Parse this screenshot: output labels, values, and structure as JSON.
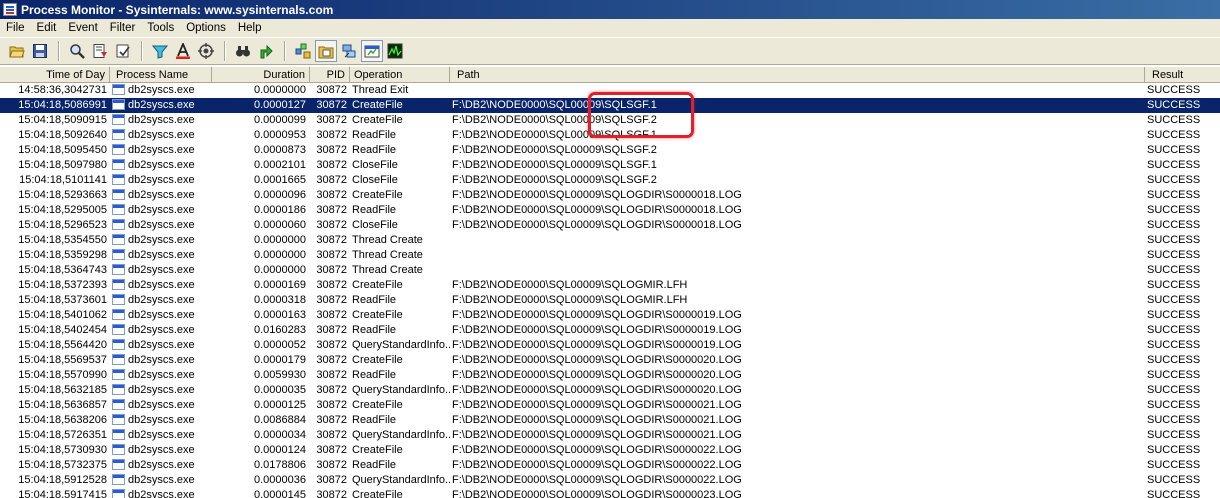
{
  "window": {
    "title": "Process Monitor - Sysinternals: www.sysinternals.com"
  },
  "menu": [
    "File",
    "Edit",
    "Event",
    "Filter",
    "Tools",
    "Options",
    "Help"
  ],
  "toolbar": [
    {
      "icon": "open-icon"
    },
    {
      "icon": "save-icon"
    },
    {
      "icon": "magnify-icon"
    },
    {
      "icon": "autoscroll-icon"
    },
    {
      "icon": "clear-icon"
    },
    {
      "icon": "filter-icon"
    },
    {
      "icon": "highlight-icon"
    },
    {
      "icon": "target-icon"
    },
    {
      "icon": "find-icon"
    },
    {
      "icon": "jump-icon"
    },
    {
      "icon": "registry-icon"
    },
    {
      "icon": "filesystem-icon"
    },
    {
      "icon": "network-icon"
    },
    {
      "icon": "process-icon"
    },
    {
      "icon": "profiling-icon"
    }
  ],
  "columns": {
    "time": "Time of Day",
    "process": "Process Name",
    "duration": "Duration",
    "pid": "PID",
    "operation": "Operation",
    "path": "Path",
    "result": "Result"
  },
  "rows": [
    {
      "time": "14:58:36,3042731",
      "process": "db2syscs.exe",
      "duration": "0.0000000",
      "pid": "30872",
      "operation": "Thread Exit",
      "path": "",
      "result": "SUCCESS"
    },
    {
      "time": "15:04:18,5086991",
      "process": "db2syscs.exe",
      "duration": "0.0000127",
      "pid": "30872",
      "operation": "CreateFile",
      "path": "F:\\DB2\\NODE0000\\SQL00009\\SQLSGF.1",
      "result": "SUCCESS",
      "selected": true
    },
    {
      "time": "15:04:18,5090915",
      "process": "db2syscs.exe",
      "duration": "0.0000099",
      "pid": "30872",
      "operation": "CreateFile",
      "path": "F:\\DB2\\NODE0000\\SQL00009\\SQLSGF.2",
      "result": "SUCCESS"
    },
    {
      "time": "15:04:18,5092640",
      "process": "db2syscs.exe",
      "duration": "0.0000953",
      "pid": "30872",
      "operation": "ReadFile",
      "path": "F:\\DB2\\NODE0000\\SQL00009\\SQLSGF.1",
      "result": "SUCCESS"
    },
    {
      "time": "15:04:18,5095450",
      "process": "db2syscs.exe",
      "duration": "0.0000873",
      "pid": "30872",
      "operation": "ReadFile",
      "path": "F:\\DB2\\NODE0000\\SQL00009\\SQLSGF.2",
      "result": "SUCCESS"
    },
    {
      "time": "15:04:18,5097980",
      "process": "db2syscs.exe",
      "duration": "0.0002101",
      "pid": "30872",
      "operation": "CloseFile",
      "path": "F:\\DB2\\NODE0000\\SQL00009\\SQLSGF.1",
      "result": "SUCCESS"
    },
    {
      "time": "15:04:18,5101141",
      "process": "db2syscs.exe",
      "duration": "0.0001665",
      "pid": "30872",
      "operation": "CloseFile",
      "path": "F:\\DB2\\NODE0000\\SQL00009\\SQLSGF.2",
      "result": "SUCCESS"
    },
    {
      "time": "15:04:18,5293663",
      "process": "db2syscs.exe",
      "duration": "0.0000096",
      "pid": "30872",
      "operation": "CreateFile",
      "path": "F:\\DB2\\NODE0000\\SQL00009\\SQLOGDIR\\S0000018.LOG",
      "result": "SUCCESS"
    },
    {
      "time": "15:04:18,5295005",
      "process": "db2syscs.exe",
      "duration": "0.0000186",
      "pid": "30872",
      "operation": "ReadFile",
      "path": "F:\\DB2\\NODE0000\\SQL00009\\SQLOGDIR\\S0000018.LOG",
      "result": "SUCCESS"
    },
    {
      "time": "15:04:18,5296523",
      "process": "db2syscs.exe",
      "duration": "0.0000060",
      "pid": "30872",
      "operation": "CloseFile",
      "path": "F:\\DB2\\NODE0000\\SQL00009\\SQLOGDIR\\S0000018.LOG",
      "result": "SUCCESS"
    },
    {
      "time": "15:04:18,5354550",
      "process": "db2syscs.exe",
      "duration": "0.0000000",
      "pid": "30872",
      "operation": "Thread Create",
      "path": "",
      "result": "SUCCESS"
    },
    {
      "time": "15:04:18,5359298",
      "process": "db2syscs.exe",
      "duration": "0.0000000",
      "pid": "30872",
      "operation": "Thread Create",
      "path": "",
      "result": "SUCCESS"
    },
    {
      "time": "15:04:18,5364743",
      "process": "db2syscs.exe",
      "duration": "0.0000000",
      "pid": "30872",
      "operation": "Thread Create",
      "path": "",
      "result": "SUCCESS"
    },
    {
      "time": "15:04:18,5372393",
      "process": "db2syscs.exe",
      "duration": "0.0000169",
      "pid": "30872",
      "operation": "CreateFile",
      "path": "F:\\DB2\\NODE0000\\SQL00009\\SQLOGMIR.LFH",
      "result": "SUCCESS"
    },
    {
      "time": "15:04:18,5373601",
      "process": "db2syscs.exe",
      "duration": "0.0000318",
      "pid": "30872",
      "operation": "ReadFile",
      "path": "F:\\DB2\\NODE0000\\SQL00009\\SQLOGMIR.LFH",
      "result": "SUCCESS"
    },
    {
      "time": "15:04:18,5401062",
      "process": "db2syscs.exe",
      "duration": "0.0000163",
      "pid": "30872",
      "operation": "CreateFile",
      "path": "F:\\DB2\\NODE0000\\SQL00009\\SQLOGDIR\\S0000019.LOG",
      "result": "SUCCESS"
    },
    {
      "time": "15:04:18,5402454",
      "process": "db2syscs.exe",
      "duration": "0.0160283",
      "pid": "30872",
      "operation": "ReadFile",
      "path": "F:\\DB2\\NODE0000\\SQL00009\\SQLOGDIR\\S0000019.LOG",
      "result": "SUCCESS"
    },
    {
      "time": "15:04:18,5564420",
      "process": "db2syscs.exe",
      "duration": "0.0000052",
      "pid": "30872",
      "operation": "QueryStandardInfo...",
      "path": "F:\\DB2\\NODE0000\\SQL00009\\SQLOGDIR\\S0000019.LOG",
      "result": "SUCCESS"
    },
    {
      "time": "15:04:18,5569537",
      "process": "db2syscs.exe",
      "duration": "0.0000179",
      "pid": "30872",
      "operation": "CreateFile",
      "path": "F:\\DB2\\NODE0000\\SQL00009\\SQLOGDIR\\S0000020.LOG",
      "result": "SUCCESS"
    },
    {
      "time": "15:04:18,5570990",
      "process": "db2syscs.exe",
      "duration": "0.0059930",
      "pid": "30872",
      "operation": "ReadFile",
      "path": "F:\\DB2\\NODE0000\\SQL00009\\SQLOGDIR\\S0000020.LOG",
      "result": "SUCCESS"
    },
    {
      "time": "15:04:18,5632185",
      "process": "db2syscs.exe",
      "duration": "0.0000035",
      "pid": "30872",
      "operation": "QueryStandardInfo...",
      "path": "F:\\DB2\\NODE0000\\SQL00009\\SQLOGDIR\\S0000020.LOG",
      "result": "SUCCESS"
    },
    {
      "time": "15:04:18,5636857",
      "process": "db2syscs.exe",
      "duration": "0.0000125",
      "pid": "30872",
      "operation": "CreateFile",
      "path": "F:\\DB2\\NODE0000\\SQL00009\\SQLOGDIR\\S0000021.LOG",
      "result": "SUCCESS"
    },
    {
      "time": "15:04:18,5638206",
      "process": "db2syscs.exe",
      "duration": "0.0086884",
      "pid": "30872",
      "operation": "ReadFile",
      "path": "F:\\DB2\\NODE0000\\SQL00009\\SQLOGDIR\\S0000021.LOG",
      "result": "SUCCESS"
    },
    {
      "time": "15:04:18,5726351",
      "process": "db2syscs.exe",
      "duration": "0.0000034",
      "pid": "30872",
      "operation": "QueryStandardInfo...",
      "path": "F:\\DB2\\NODE0000\\SQL00009\\SQLOGDIR\\S0000021.LOG",
      "result": "SUCCESS"
    },
    {
      "time": "15:04:18,5730930",
      "process": "db2syscs.exe",
      "duration": "0.0000124",
      "pid": "30872",
      "operation": "CreateFile",
      "path": "F:\\DB2\\NODE0000\\SQL00009\\SQLOGDIR\\S0000022.LOG",
      "result": "SUCCESS"
    },
    {
      "time": "15:04:18,5732375",
      "process": "db2syscs.exe",
      "duration": "0.0178806",
      "pid": "30872",
      "operation": "ReadFile",
      "path": "F:\\DB2\\NODE0000\\SQL00009\\SQLOGDIR\\S0000022.LOG",
      "result": "SUCCESS"
    },
    {
      "time": "15:04:18,5912528",
      "process": "db2syscs.exe",
      "duration": "0.0000036",
      "pid": "30872",
      "operation": "QueryStandardInfo...",
      "path": "F:\\DB2\\NODE0000\\SQL00009\\SQLOGDIR\\S0000022.LOG",
      "result": "SUCCESS"
    },
    {
      "time": "15:04:18,5917415",
      "process": "db2syscs.exe",
      "duration": "0.0000145",
      "pid": "30872",
      "operation": "CreateFile",
      "path": "F:\\DB2\\NODE0000\\SQL00009\\SQLOGDIR\\S0000023.LOG",
      "result": "SUCCESS"
    }
  ]
}
